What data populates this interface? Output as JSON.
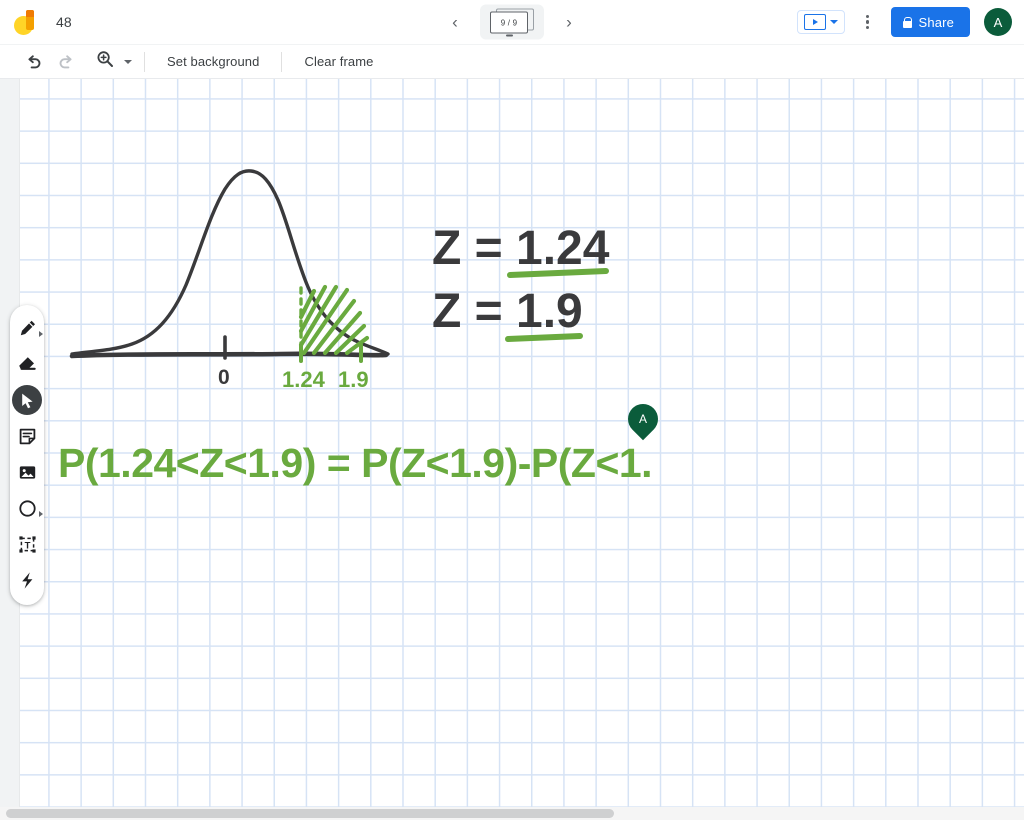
{
  "app": {
    "logo_icon": "jamboard-logo-icon",
    "doc_title": "48"
  },
  "frame_nav": {
    "prev_icon": "chevron-left-icon",
    "next_icon": "chevron-right-icon",
    "frame_counter": "9 / 9",
    "frame_icon": "frame-bar-icon"
  },
  "topbar_right": {
    "present_icon": "present-to-window-icon",
    "present_caret_icon": "chevron-down-icon",
    "more_icon": "more-vertical-icon",
    "share_label": "Share",
    "share_lock_icon": "lock-icon",
    "share_color": "#1a73e8",
    "avatar_initial": "A",
    "avatar_color": "#0b5c3b"
  },
  "toolbar": {
    "undo_icon": "undo-icon",
    "redo_icon": "redo-icon",
    "zoom_icon": "magnifier-plus-icon",
    "zoom_caret_icon": "chevron-down-icon",
    "set_background_label": "Set background",
    "clear_frame_label": "Clear frame"
  },
  "toolrail": {
    "items": [
      {
        "name": "pen",
        "icon": "pen-icon",
        "active": false,
        "has_submenu": true
      },
      {
        "name": "eraser",
        "icon": "eraser-icon",
        "active": false,
        "has_submenu": false
      },
      {
        "name": "select",
        "icon": "cursor-arrow-icon",
        "active": true,
        "has_submenu": false
      },
      {
        "name": "sticky-note",
        "icon": "sticky-note-icon",
        "active": false,
        "has_submenu": false
      },
      {
        "name": "image",
        "icon": "image-icon",
        "active": false,
        "has_submenu": false
      },
      {
        "name": "shape",
        "icon": "circle-shape-icon",
        "active": false,
        "has_submenu": true
      },
      {
        "name": "text-box",
        "icon": "text-box-icon",
        "active": false,
        "has_submenu": false
      },
      {
        "name": "laser",
        "icon": "laser-pointer-icon",
        "active": false,
        "has_submenu": false
      }
    ]
  },
  "canvas": {
    "background": "grid",
    "grid_color": "#d6e3f5",
    "ink_black": "#3a3a3c",
    "ink_green": "#6aaa3f",
    "drawing": {
      "curve_label": "normal-distribution-bell-curve",
      "axis_tick_label": "0",
      "region_lower_label": "1.24",
      "region_upper_label": "1.9",
      "shaded_region": "hatched-area-between-1.24-and-1.9",
      "equation_line_1": "Z = 1.24",
      "equation_line_2": "Z = 1.9",
      "probability_expression": "P(1.24<Z<1.9) = P(Z<1.9)-P(Z<1."
    }
  },
  "collab": {
    "cursor_initial": "A",
    "cursor_color": "#0b5c3b"
  },
  "scrollbar": {
    "orientation": "horizontal"
  }
}
